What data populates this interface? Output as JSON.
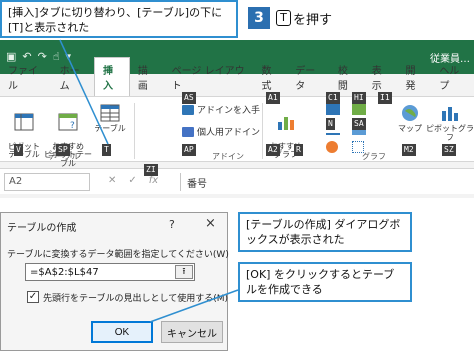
{
  "callouts": {
    "top_left": "[挿入]タブに切り替わり、[テーブル]の下に[T]と表示された",
    "step_number": "3",
    "step_key": "T",
    "step_suffix": "を押す",
    "dialog_note": "[テーブルの作成] ダイアログボックスが表示された",
    "ok_note": "[OK] をクリックするとテーブルを作成できる"
  },
  "excel": {
    "title_user": "従業員…",
    "tabs": [
      "ファイル",
      "ホーム",
      "挿入",
      "描画",
      "ページ レイアウト",
      "数式",
      "データ",
      "校閲",
      "表示",
      "開発",
      "ヘルプ"
    ],
    "active_tab": "挿入",
    "ribbon": {
      "pivot": "ピボット\nテーブル",
      "recommended_pivot": "おすすめ\nピボットテーブル",
      "table": "テーブル",
      "group_table": "テーブル",
      "get_addins": "アドインを入手",
      "personal_addins": "個人用アドイン",
      "group_addins": "アドイン",
      "recommended_charts": "おすすめ\nグラフ",
      "group_charts": "グラフ",
      "map": "マップ",
      "pivot_chart": "ピボットグラフ"
    },
    "keytips": {
      "t": "T",
      "v": "V",
      "sp": "SP",
      "as": "AS",
      "a1": "A1",
      "ap": "AP",
      "a2": "A2",
      "r": "R",
      "c1": "C1",
      "n": "N",
      "sa": "SA",
      "hi": "HI",
      "i1": "I1",
      "m2": "M2",
      "sz": "SZ",
      "zi": "ZI"
    },
    "namebox": "A2",
    "formula": "番号"
  },
  "dialog": {
    "title": "テーブルの作成",
    "help": "?",
    "close": "×",
    "prompt": "テーブルに変換するデータ範囲を指定してください(W)",
    "range": "=$A$2:$L$47",
    "header_checkbox": "先頭行をテーブルの見出しとして使用する(M)",
    "ok": "OK",
    "cancel": "キャンセル"
  },
  "colors": {
    "excel_green": "#217346",
    "callout_border": "#2f8fd0",
    "keytip_bg": "#3f3f3f"
  }
}
